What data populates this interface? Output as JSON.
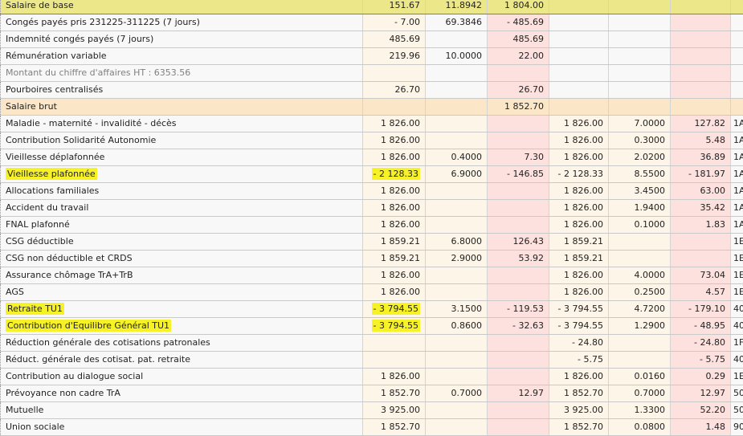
{
  "rows": [
    {
      "type": "base",
      "label": "Salaire de base",
      "v": [
        "151.67",
        "11.8942",
        "1 804.00",
        "",
        "",
        "",
        ""
      ]
    },
    {
      "type": "upper",
      "label": "Congés payés pris 231225-311225 (7 jours)",
      "v": [
        "- 7.00",
        "69.3846",
        "- 485.69",
        "",
        "",
        "",
        ""
      ]
    },
    {
      "type": "upper",
      "label": "Indemnité congés payés (7 jours)",
      "v": [
        "485.69",
        "",
        "485.69",
        "",
        "",
        "",
        ""
      ]
    },
    {
      "type": "upper",
      "label": "Rémunération variable",
      "v": [
        "219.96",
        "10.0000",
        "22.00",
        "",
        "",
        "",
        ""
      ]
    },
    {
      "type": "upper note",
      "label": "Montant du chiffre d'affaires HT : 6353.56",
      "v": [
        "",
        "",
        "",
        "",
        "",
        "",
        ""
      ]
    },
    {
      "type": "upper",
      "label": "Pourboires centralisés",
      "v": [
        "26.70",
        "",
        "26.70",
        "",
        "",
        "",
        ""
      ]
    },
    {
      "type": "brut",
      "label": "Salaire brut",
      "v": [
        "",
        "",
        "1 852.70",
        "",
        "",
        "",
        ""
      ]
    },
    {
      "type": "lower",
      "label": "Maladie - maternité - invalidité - décès",
      "v": [
        "1 826.00",
        "",
        "",
        "1 826.00",
        "7.0000",
        "127.82",
        "1A"
      ]
    },
    {
      "type": "lower",
      "label": "Contribution Solidarité Autonomie",
      "v": [
        "1 826.00",
        "",
        "",
        "1 826.00",
        "0.3000",
        "5.48",
        "1A"
      ]
    },
    {
      "type": "lower",
      "label": "Vieillesse déplafonnée",
      "v": [
        "1 826.00",
        "0.4000",
        "7.30",
        "1 826.00",
        "2.0200",
        "36.89",
        "1A"
      ]
    },
    {
      "type": "lower",
      "label": "Vieillesse plafonnée",
      "highlight": true,
      "v": [
        "- 2 128.33",
        "6.9000",
        "- 146.85",
        "- 2 128.33",
        "8.5500",
        "- 181.97",
        "1A"
      ]
    },
    {
      "type": "lower",
      "label": "Allocations familiales",
      "v": [
        "1 826.00",
        "",
        "",
        "1 826.00",
        "3.4500",
        "63.00",
        "1A"
      ]
    },
    {
      "type": "lower",
      "label": "Accident du travail",
      "v": [
        "1 826.00",
        "",
        "",
        "1 826.00",
        "1.9400",
        "35.42",
        "1A"
      ]
    },
    {
      "type": "lower",
      "label": "FNAL plafonné",
      "v": [
        "1 826.00",
        "",
        "",
        "1 826.00",
        "0.1000",
        "1.83",
        "1A"
      ]
    },
    {
      "type": "lower",
      "label": "CSG déductible",
      "v": [
        "1 859.21",
        "6.8000",
        "126.43",
        "1 859.21",
        "",
        "",
        "1E"
      ]
    },
    {
      "type": "lower",
      "label": "CSG non déductible et CRDS",
      "v": [
        "1 859.21",
        "2.9000",
        "53.92",
        "1 859.21",
        "",
        "",
        "1E"
      ]
    },
    {
      "type": "lower",
      "label": "Assurance chômage TrA+TrB",
      "v": [
        "1 826.00",
        "",
        "",
        "1 826.00",
        "4.0000",
        "73.04",
        "1E"
      ]
    },
    {
      "type": "lower",
      "label": "AGS",
      "v": [
        "1 826.00",
        "",
        "",
        "1 826.00",
        "0.2500",
        "4.57",
        "1E"
      ]
    },
    {
      "type": "lower",
      "label": "Retraite TU1",
      "highlight": true,
      "v": [
        "- 3 794.55",
        "3.1500",
        "- 119.53",
        "- 3 794.55",
        "4.7200",
        "- 179.10",
        "40"
      ]
    },
    {
      "type": "lower",
      "label": "Contribution d'Equilibre Général TU1",
      "highlight": true,
      "v": [
        "- 3 794.55",
        "0.8600",
        "- 32.63",
        "- 3 794.55",
        "1.2900",
        "- 48.95",
        "40"
      ]
    },
    {
      "type": "lower",
      "label": "Réduction générale des cotisations patronales",
      "v": [
        "",
        "",
        "",
        "- 24.80",
        "",
        "- 24.80",
        "1F"
      ]
    },
    {
      "type": "lower",
      "label": "Réduct. générale des cotisat. pat. retraite",
      "v": [
        "",
        "",
        "",
        "- 5.75",
        "",
        "- 5.75",
        "40"
      ]
    },
    {
      "type": "lower",
      "label": "Contribution au dialogue social",
      "v": [
        "1 826.00",
        "",
        "",
        "1 826.00",
        "0.0160",
        "0.29",
        "1E"
      ]
    },
    {
      "type": "lower",
      "label": "Prévoyance non cadre TrA",
      "v": [
        "1 852.70",
        "0.7000",
        "12.97",
        "1 852.70",
        "0.7000",
        "12.97",
        "50"
      ]
    },
    {
      "type": "lower",
      "label": "Mutuelle",
      "v": [
        "3 925.00",
        "",
        "",
        "3 925.00",
        "1.3300",
        "52.20",
        "50"
      ]
    },
    {
      "type": "lower",
      "label": "Union sociale",
      "v": [
        "1 852.70",
        "",
        "",
        "1 852.70",
        "0.0800",
        "1.48",
        "90"
      ]
    }
  ]
}
